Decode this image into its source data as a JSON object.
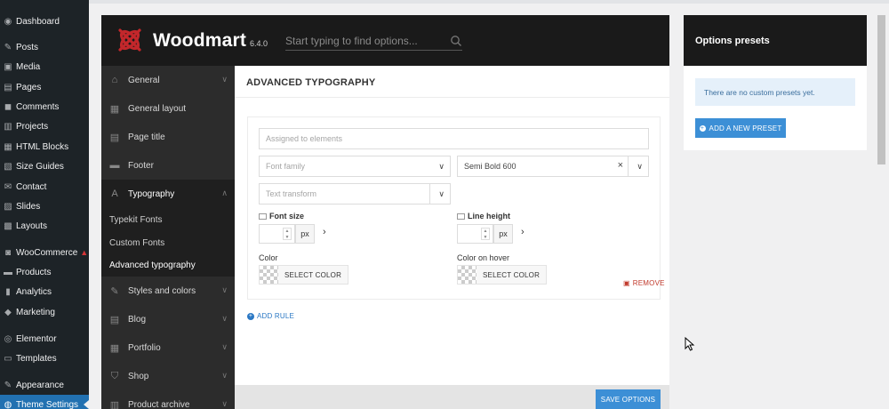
{
  "wp_menu": [
    {
      "label": "Dashboard",
      "icon": "dashboard-icon",
      "glyph": "◉"
    },
    {
      "label": "Posts",
      "icon": "pin-icon",
      "glyph": "✎"
    },
    {
      "label": "Media",
      "icon": "media-icon",
      "glyph": "▣"
    },
    {
      "label": "Pages",
      "icon": "pages-icon",
      "glyph": "▤"
    },
    {
      "label": "Comments",
      "icon": "comments-icon",
      "glyph": "◼"
    },
    {
      "label": "Projects",
      "icon": "projects-icon",
      "glyph": "▥"
    },
    {
      "label": "HTML Blocks",
      "icon": "html-blocks-icon",
      "glyph": "▦"
    },
    {
      "label": "Size Guides",
      "icon": "size-guides-icon",
      "glyph": "▧"
    },
    {
      "label": "Contact",
      "icon": "mail-icon",
      "glyph": "✉"
    },
    {
      "label": "Slides",
      "icon": "slides-icon",
      "glyph": "▨"
    },
    {
      "label": "Layouts",
      "icon": "layouts-icon",
      "glyph": "▩"
    },
    {
      "label": "WooCommerce",
      "icon": "woocommerce-icon",
      "glyph": "◙",
      "warning": "▲"
    },
    {
      "label": "Products",
      "icon": "products-icon",
      "glyph": "▬"
    },
    {
      "label": "Analytics",
      "icon": "analytics-icon",
      "glyph": "▮"
    },
    {
      "label": "Marketing",
      "icon": "marketing-icon",
      "glyph": "◆"
    },
    {
      "label": "Elementor",
      "icon": "elementor-icon",
      "glyph": "◎"
    },
    {
      "label": "Templates",
      "icon": "templates-icon",
      "glyph": "▭"
    },
    {
      "label": "Appearance",
      "icon": "appearance-icon",
      "glyph": "✎"
    },
    {
      "label": "Theme Settings",
      "icon": "theme-settings-icon",
      "glyph": "◍",
      "active": true
    }
  ],
  "header": {
    "brand": "Woodmart",
    "version": "6.4.0",
    "search_placeholder": "Start typing to find options..."
  },
  "nav": {
    "items": [
      {
        "label": "General",
        "icon": "home-icon",
        "glyph": "⌂",
        "chevron": "∨"
      },
      {
        "label": "General layout",
        "icon": "layout-icon",
        "glyph": "▦"
      },
      {
        "label": "Page title",
        "icon": "page-title-icon",
        "glyph": "▤"
      },
      {
        "label": "Footer",
        "icon": "footer-icon",
        "glyph": "▬"
      },
      {
        "label": "Typography",
        "icon": "typography-icon",
        "glyph": "A",
        "chevron": "∧",
        "open": true
      }
    ],
    "sub_items": [
      {
        "label": "Typekit Fonts"
      },
      {
        "label": "Custom Fonts"
      },
      {
        "label": "Advanced typography",
        "current": true
      }
    ],
    "items_after": [
      {
        "label": "Styles and colors",
        "icon": "brush-icon",
        "glyph": "✎",
        "chevron": "∨"
      },
      {
        "label": "Blog",
        "icon": "blog-icon",
        "glyph": "▤",
        "chevron": "∨"
      },
      {
        "label": "Portfolio",
        "icon": "portfolio-icon",
        "glyph": "▦",
        "chevron": "∨"
      },
      {
        "label": "Shop",
        "icon": "shop-icon",
        "glyph": "⛉",
        "chevron": "∨"
      },
      {
        "label": "Product archive",
        "icon": "product-archive-icon",
        "glyph": "▥",
        "chevron": "∨"
      }
    ]
  },
  "content": {
    "section_title": "ADVANCED TYPOGRAPHY",
    "assigned_placeholder": "Assigned to elements",
    "font_family_placeholder": "Font family",
    "font_weight_value": "Semi Bold 600",
    "text_transform_placeholder": "Text transform",
    "font_size_label": "Font size",
    "line_height_label": "Line height",
    "unit_px": "px",
    "more_arrow": "›",
    "color_label": "Color",
    "color_hover_label": "Color on hover",
    "select_color": "SELECT COLOR",
    "remove": "REMOVE",
    "add_rule": "ADD RULE",
    "save": "SAVE OPTIONS",
    "dropdown_glyph": "∨",
    "clear_glyph": "×"
  },
  "presets": {
    "title": "Options presets",
    "empty_text": "There are no custom presets yet.",
    "add_button": "ADD A NEW PRESET"
  },
  "colors": {
    "accent": "#3c8fd6",
    "wp_active": "#2271b1",
    "remove": "#c0392b"
  }
}
